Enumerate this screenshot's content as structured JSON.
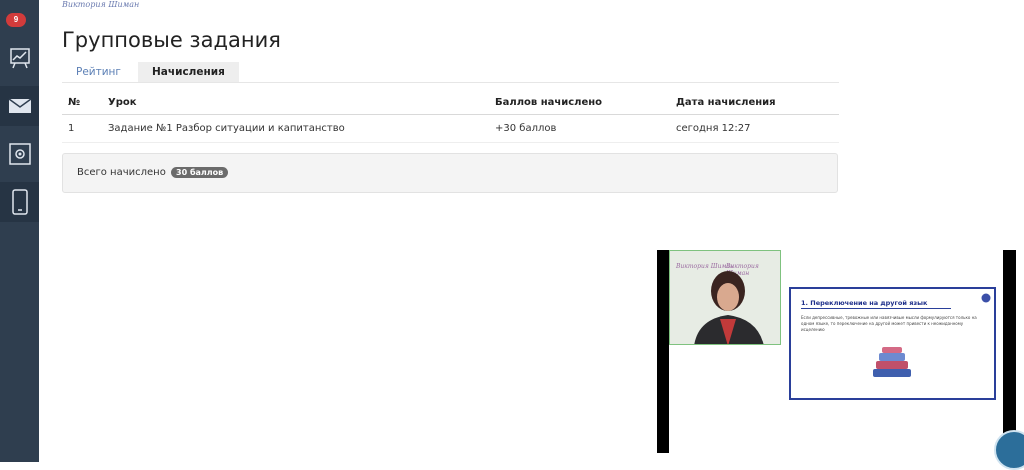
{
  "sidebar": {
    "notification_count": "9",
    "items": [
      {
        "icon": "chart-icon"
      },
      {
        "icon": "mail-icon"
      },
      {
        "icon": "settings-icon"
      },
      {
        "icon": "phone-icon"
      }
    ]
  },
  "header": {
    "brand": "Виктория Шиман",
    "title": "Групповые задания"
  },
  "tabs": [
    {
      "label": "Рейтинг",
      "active": false
    },
    {
      "label": "Начисления",
      "active": true
    }
  ],
  "table": {
    "columns": [
      "№",
      "Урок",
      "Баллов начислено",
      "Дата начисления"
    ],
    "rows": [
      [
        "1",
        "Задание №1 Разбор ситуации и капитанство",
        "+30 баллов",
        "сегодня 12:27"
      ]
    ]
  },
  "summary": {
    "label": "Всего начислено",
    "total": "30 баллов"
  },
  "video": {
    "cam_logo_1": "Виктория Шиман",
    "cam_logo_2": "Виктория Шиман",
    "slide_title": "1. Переключение на другой язык",
    "slide_text": "Если депрессивные, тревожные или навязчивые мысли формулируются только на одном языке, то переключение на другой может привести к неожиданному исцелению"
  },
  "colors": {
    "sidebar": "#2f3e4f",
    "accent": "#5b7fb5",
    "badge": "#d23b3b",
    "slide_border": "#2a3f9a"
  }
}
